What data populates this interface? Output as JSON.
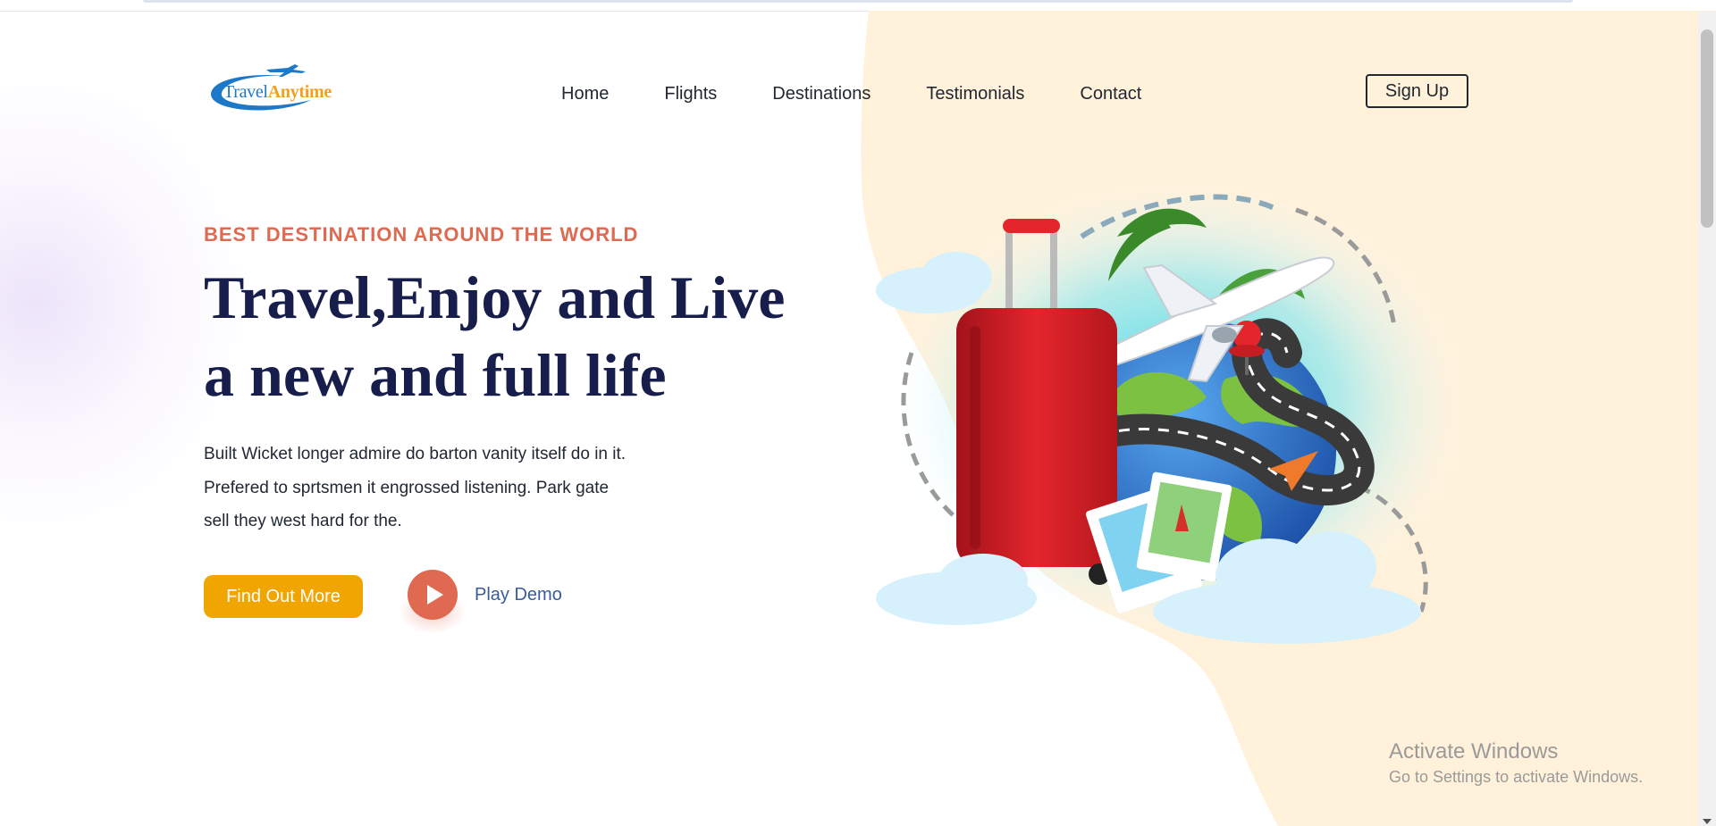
{
  "brand": {
    "name_part1": "Travel",
    "name_part2": "Anytime",
    "colors": {
      "primary_blue": "#1d78c8",
      "accent_orange": "#f0a020"
    }
  },
  "nav": {
    "items": [
      {
        "label": "Home"
      },
      {
        "label": "Flights"
      },
      {
        "label": "Destinations"
      },
      {
        "label": "Testimonials"
      },
      {
        "label": "Contact"
      }
    ],
    "signup_label": "Sign Up"
  },
  "hero": {
    "eyebrow": "BEST DESTINATION AROUND THE WORLD",
    "headline_line1": "Travel,Enjoy and Live",
    "headline_line2": "a new and full life",
    "description_line1": "Built Wicket longer admire do barton vanity itself do in it.",
    "description_line2": "Prefered to sprtsmen it engrossed listening. Park gate",
    "description_line3": "sell they west hard for the.",
    "cta_primary": "Find Out More",
    "cta_secondary": "Play Demo",
    "colors": {
      "eyebrow": "#df6951",
      "headline": "#181e4b",
      "cta_primary_bg": "#f1a501",
      "play_button": "#df6951",
      "peach_bg": "#fff1da"
    },
    "illustration_icons": [
      "suitcase-icon",
      "airplane-icon",
      "globe-icon",
      "location-pin-icon",
      "photo-icon",
      "cloud-icon"
    ]
  },
  "os_overlay": {
    "title": "Activate Windows",
    "subtitle": "Go to Settings to activate Windows."
  }
}
